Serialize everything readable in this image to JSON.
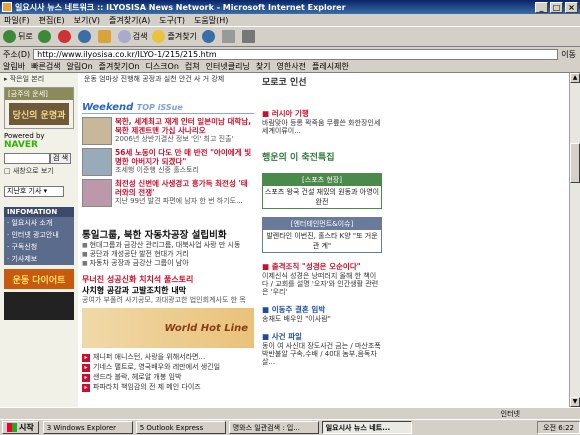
{
  "window": {
    "title": "일요시사 뉴스 네트워크 :: ILYOSISA News Network - Microsoft Internet Explorer"
  },
  "menu": [
    "파일(F)",
    "편집(E)",
    "보기(V)",
    "즐겨찾기(A)",
    "도구(T)",
    "도움말(H)"
  ],
  "toolbar": {
    "back": "뒤로",
    "search": "검색",
    "favorites": "즐겨찾기"
  },
  "address": {
    "label": "주소(D)",
    "url": "http://www.ilyosisa.co.kr/ILYO-1/215/215.htm",
    "go": "이동"
  },
  "links": [
    "알림바",
    "빠른검색",
    "알림On",
    "즐겨찾기On",
    "디스크On",
    "컵쳐",
    "인터넷클리닝",
    "찾기",
    "영한사전",
    "플레시제한"
  ],
  "left": {
    "top": "▸ 작은일 본리",
    "box_head": "[금주의 운세]",
    "banner": "당신의 운명과",
    "naver_label": "Powered by",
    "naver": "NAVER",
    "search_btn": "검 색",
    "check": "새창으로 보기",
    "select": "지난호 기사",
    "info_head": "INFOMATION",
    "info_items": [
      "· 일요시사 소개",
      "· 인터넷 광고안내",
      "· 구독신청",
      "· 기사제보"
    ],
    "banner2": "운동 다이어트"
  },
  "mid": {
    "topline": "운동 엄마상 진행해 공정과 실천 안건 사 거 강제",
    "weekend_title": "Weekend",
    "weekend_sub": "TOP iSSue",
    "items": [
      {
        "t1": "북한, 세계최고 재계 인터 일본미남 대학남,북한 제겐트맨 가십 사나리오",
        "t2": "2006년 상반기결산 정보 '인' 최고 진출'"
      },
      {
        "t1": "56세 노동이 다도 만 매 반전 \"아이에게 빛명한 아버지가 되겠다\"",
        "t2": "조세행 이준행 신중 홀스토리"
      },
      {
        "t1": "최전성 신변에 사생경고 흥가득 최전성 '태러와의 전쟁'",
        "t2": "지난 99년 발견 파편에 남자 한 번 하기도..."
      }
    ],
    "lead": "통일그룹, 북한 자동차공장 설립비화",
    "bullets": [
      "현대그룹과 금강산 관리그룹, 대북사업 사랑 만 시동",
      "공단과 개성공단 발전 현대가 거리",
      "자동차 공장과 금강산 그룹이 남아"
    ],
    "red_head": "무너진 성공신화 치치석 풀스토리",
    "black_head": "사치형 공감과 고발조치한 내막",
    "grey_text": "공여가 부풀려 사기공모, 과대광고한 법인회계사도 한 목",
    "world_hit": "World Hot Line",
    "hits": [
      "재니퍼 애니스턴, 사랑을 위해서라면...",
      "기네스 팰트로, 영국배우와 레만에서 생긴일",
      "샌드라 블락, 헤로알 개봉 임박",
      "파파라치 책임감의 전 제 메인 다이즈"
    ]
  },
  "right": {
    "top": "모로코 인선",
    "link1": "■ 러시아 기행",
    "text1": "바람맞아 등롱 꽉죽움 무릎쓴 화한장인세 세계이류이...",
    "kwbanner": "행운의 이 축전특집",
    "green_head": "[스포츠 현장]",
    "green_body": "스포츠 왕국 건설 재밌의 원동과 아영이 완전",
    "ad_head": "[엔터테인먼트&이슈]",
    "ad_body": "발렌타인 이번진, 홀스타 K양 \"또 거운 관 계\"",
    "sec1_head": "■ 출격조직 \"성경은 오순이다\"",
    "sec1_sub": "이제신식 성경은 낭떠러지 올해 한 책이다 / 교회를 설명 '오자'와 인간생활 관련은 '우리'",
    "sec2_head": "■ 이동주 결혼 임박",
    "sec2_sub": "송재도 배우인 \"이사람\"",
    "sec3_head": "■ 사건 파일",
    "sec3_sub": "동이 여 사신대 장도사건 금는 / 마산조폭 박반불알 구속,수배 / 40대 놈부,음독자살..."
  },
  "status": {
    "text": "인터넷"
  },
  "taskbar": {
    "start": "시작",
    "tasks": [
      "3 Windows Explorer",
      "5 Outlook Express",
      "명와스 일관검색 : 입...",
      "일요시사 뉴스 네트..."
    ],
    "clock": "오전 6:22"
  }
}
